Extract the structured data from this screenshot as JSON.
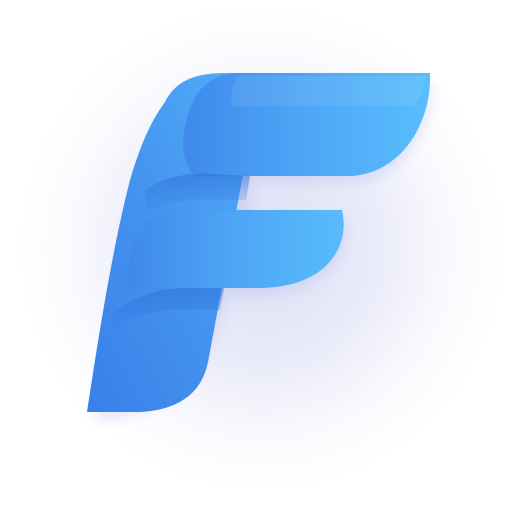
{
  "logo": {
    "glyph": "F",
    "icon": "stylized-letter-f-icon",
    "colors": {
      "light": "#55b9fb",
      "mid": "#4aa2f3",
      "dark": "#3d83ea",
      "glow": "#d9dbf3",
      "background": "#ffffff"
    }
  }
}
